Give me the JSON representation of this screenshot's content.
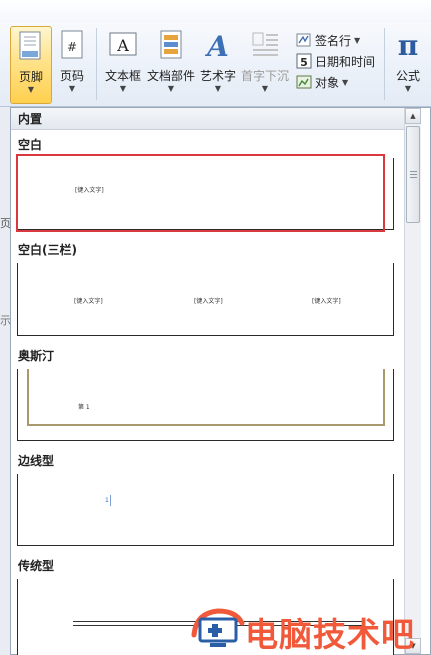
{
  "ribbon": {
    "buttons": [
      {
        "id": "footer",
        "label": "页脚"
      },
      {
        "id": "page-number",
        "label": "页码"
      },
      {
        "id": "text-box",
        "label": "文本框"
      },
      {
        "id": "quick-parts",
        "label": "文档部件"
      },
      {
        "id": "wordart",
        "label": "艺术字"
      },
      {
        "id": "drop-cap",
        "label": "首字下沉"
      },
      {
        "id": "equation",
        "label": "公式"
      }
    ],
    "small_buttons": {
      "signature": "签名行",
      "datetime": "日期和时间",
      "object": "对象"
    },
    "icon_glyphs": {
      "page_number_mark": "#",
      "text_box_mark": "A",
      "wordart_mark": "A",
      "equation_mark": "π",
      "datetime_mark": "5"
    }
  },
  "doc_sliver": {
    "char_top": "页",
    "char_mid": "示"
  },
  "gallery": {
    "header": "内置",
    "placeholder": "[键入文字]",
    "sections": [
      {
        "title": "空白"
      },
      {
        "title": "空白(三栏)"
      },
      {
        "title": "奥斯汀",
        "page_marker": "第 1"
      },
      {
        "title": "边线型",
        "page_marker": "1"
      },
      {
        "title": "传统型"
      }
    ]
  },
  "watermark": {
    "text": "电脑技术吧"
  },
  "colors": {
    "selection": "#d9383f",
    "active_button": "#ffd04f",
    "watermark": "#f0593a"
  }
}
